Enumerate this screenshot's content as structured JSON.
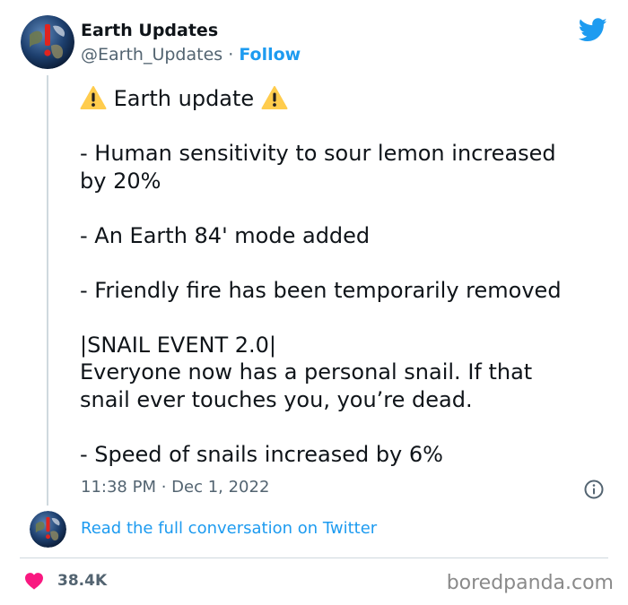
{
  "author": {
    "name": "Earth Updates",
    "handle": "@Earth_Updates",
    "separator": "·",
    "follow_label": "Follow"
  },
  "tweet": {
    "headline": "Earth update",
    "lines": [
      "- Human sensitivity to sour lemon increased",
      "by 20%",
      "- An Earth 84' mode added",
      "- Friendly fire has been temporarily removed",
      "|SNAIL EVENT 2.0|",
      "Everyone now has a personal snail. If that",
      "snail ever touches you, you’re dead.",
      "- Speed of snails increased by 6%"
    ],
    "timestamp": "11:38 PM · Dec 1, 2022"
  },
  "conversation": {
    "read_more_label": "Read the full conversation on Twitter"
  },
  "engagement": {
    "likes": "38.4K"
  },
  "watermark": "boredpanda.com",
  "colors": {
    "accent": "#1d9bf0",
    "text": "#0f1419",
    "muted": "#536471",
    "heart": "#f91880",
    "warning": "#ffcc4d"
  },
  "icons": [
    "earth-avatar-icon",
    "twitter-bird-icon",
    "warning-icon",
    "info-icon",
    "heart-icon"
  ]
}
